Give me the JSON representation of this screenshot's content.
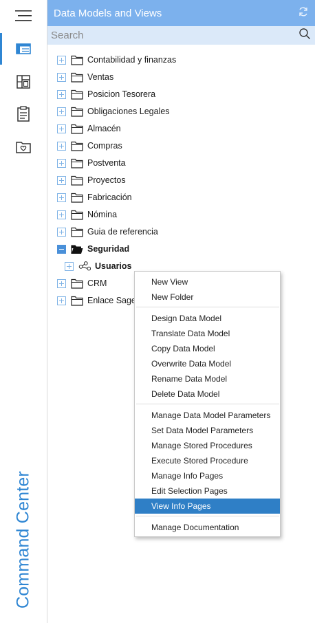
{
  "rail": {
    "menu_icon": "hamburger-icon",
    "items": [
      {
        "icon": "data-models-icon",
        "active": true
      },
      {
        "icon": "dashboard-icon",
        "active": false
      },
      {
        "icon": "clipboard-icon",
        "active": false
      },
      {
        "icon": "favorites-folder-icon",
        "active": false
      }
    ],
    "title": "Command Center"
  },
  "header": {
    "title": "Data Models and Views",
    "refresh_icon": "refresh-icon"
  },
  "search": {
    "placeholder": "Search",
    "value": ""
  },
  "tree": {
    "items": [
      {
        "label": "Contabilidad y finanzas",
        "expander": "plus",
        "icon": "folder-icon",
        "bold": false,
        "level": 0
      },
      {
        "label": "Ventas",
        "expander": "plus",
        "icon": "folder-icon",
        "bold": false,
        "level": 0
      },
      {
        "label": "Posicion Tesorera",
        "expander": "plus",
        "icon": "folder-icon",
        "bold": false,
        "level": 0
      },
      {
        "label": "Obligaciones Legales",
        "expander": "plus",
        "icon": "folder-icon",
        "bold": false,
        "level": 0
      },
      {
        "label": "Almacén",
        "expander": "plus",
        "icon": "folder-icon",
        "bold": false,
        "level": 0
      },
      {
        "label": "Compras",
        "expander": "plus",
        "icon": "folder-icon",
        "bold": false,
        "level": 0
      },
      {
        "label": "Postventa",
        "expander": "plus",
        "icon": "folder-icon",
        "bold": false,
        "level": 0
      },
      {
        "label": "Proyectos",
        "expander": "plus",
        "icon": "folder-icon",
        "bold": false,
        "level": 0
      },
      {
        "label": "Fabricación",
        "expander": "plus",
        "icon": "folder-icon",
        "bold": false,
        "level": 0
      },
      {
        "label": "Nómina",
        "expander": "plus",
        "icon": "folder-icon",
        "bold": false,
        "level": 0
      },
      {
        "label": "Guia de referencia",
        "expander": "plus",
        "icon": "folder-icon",
        "bold": false,
        "level": 0
      },
      {
        "label": "Seguridad",
        "expander": "minus",
        "icon": "folder-open-icon",
        "bold": true,
        "level": 0
      },
      {
        "label": "Usuarios",
        "expander": "plus",
        "icon": "data-model-icon",
        "bold": true,
        "level": 1
      },
      {
        "label": "CRM",
        "expander": "plus",
        "icon": "folder-icon",
        "bold": false,
        "level": 0
      },
      {
        "label": "Enlace Sage",
        "expander": "plus",
        "icon": "folder-icon",
        "bold": false,
        "level": 0
      }
    ]
  },
  "context_menu": {
    "groups": [
      [
        "New View",
        "New Folder"
      ],
      [
        "Design Data Model",
        "Translate Data Model",
        "Copy Data Model",
        "Overwrite Data Model",
        "Rename Data Model",
        "Delete Data Model"
      ],
      [
        "Manage Data Model Parameters",
        "Set Data Model Parameters",
        "Manage Stored Procedures",
        "Execute Stored Procedure",
        "Manage Info Pages",
        "Edit Selection Pages",
        "View Info Pages"
      ],
      [
        "Manage Documentation"
      ]
    ],
    "highlighted": "View Info Pages"
  },
  "colors": {
    "accent": "#2f86d3",
    "header_bg": "#7cb1ed",
    "search_bg": "#dbe9f9",
    "menu_highlight": "#2f7fc6"
  }
}
